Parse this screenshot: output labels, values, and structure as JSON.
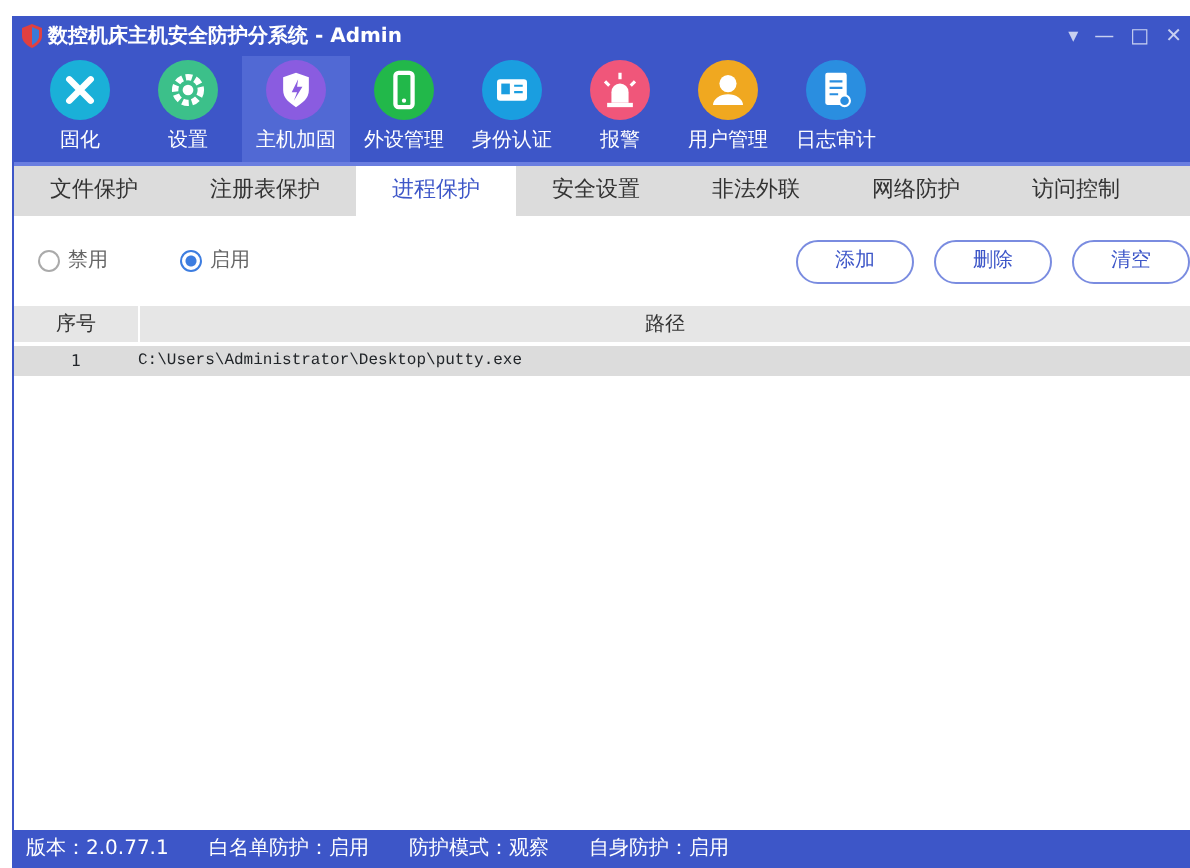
{
  "window": {
    "title": "数控机床主机安全防护分系统 - Admin",
    "controls": [
      "▾",
      "—",
      "□",
      "✕"
    ]
  },
  "toolbar": [
    {
      "label": "固化",
      "kind": "tools",
      "color": "#1ab0d8",
      "selected": false
    },
    {
      "label": "设置",
      "kind": "gear",
      "color": "#3cc08a",
      "selected": false
    },
    {
      "label": "主机加固",
      "kind": "shield",
      "color": "#8a5ce0",
      "selected": true
    },
    {
      "label": "外设管理",
      "kind": "phone",
      "color": "#22b84a",
      "selected": false
    },
    {
      "label": "身份认证",
      "kind": "card",
      "color": "#1a9ee0",
      "selected": false
    },
    {
      "label": "报警",
      "kind": "alarm",
      "color": "#f0567a",
      "selected": false
    },
    {
      "label": "用户管理",
      "kind": "user",
      "color": "#f0a820",
      "selected": false
    },
    {
      "label": "日志审计",
      "kind": "log",
      "color": "#2a8ee0",
      "selected": false
    }
  ],
  "tabs": [
    {
      "label": "文件保护",
      "selected": false
    },
    {
      "label": "注册表保护",
      "selected": false
    },
    {
      "label": "进程保护",
      "selected": true
    },
    {
      "label": "安全设置",
      "selected": false
    },
    {
      "label": "非法外联",
      "selected": false
    },
    {
      "label": "网络防护",
      "selected": false
    },
    {
      "label": "访问控制",
      "selected": false
    }
  ],
  "mode": [
    {
      "label": "禁用",
      "selected": false
    },
    {
      "label": "启用",
      "selected": true
    }
  ],
  "buttons": [
    "添加",
    "删除",
    "清空"
  ],
  "table": {
    "columns": [
      "序号",
      "路径"
    ],
    "rows": [
      [
        "1",
        "C:\\Users\\Administrator\\Desktop\\putty.exe"
      ]
    ]
  },
  "status_bar": [
    "版本：2.0.77.1",
    "白名单防护：启用",
    "防护模式：观察",
    "自身防护：启用"
  ]
}
